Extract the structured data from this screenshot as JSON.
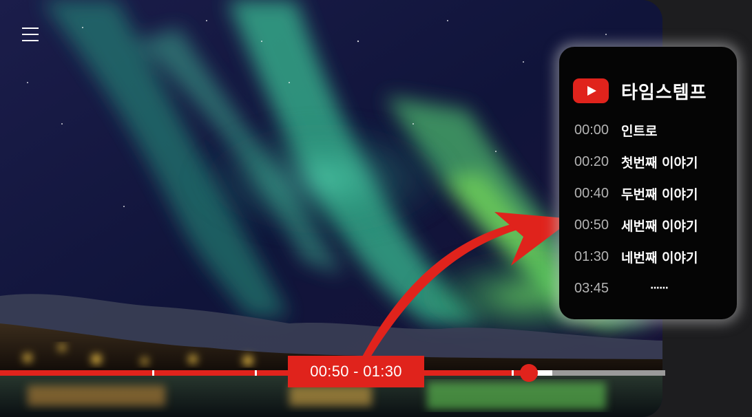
{
  "player": {
    "time_range_label": "00:50 - 01:30",
    "progress": {
      "played_fraction": 0.795,
      "buffered_fraction": 0.83,
      "chapter_marker_fractions": [
        0.229,
        0.383,
        0.769
      ]
    }
  },
  "icons": {
    "menu": "hamburger-menu-icon",
    "logo": "youtube-play-icon"
  },
  "timestamps_panel": {
    "title": "타임스템프",
    "items": [
      {
        "time": "00:00",
        "label": "인트로"
      },
      {
        "time": "00:20",
        "label": "첫번째 이야기"
      },
      {
        "time": "00:40",
        "label": "두번째 이야기"
      },
      {
        "time": "00:50",
        "label": "세번째 이야기"
      },
      {
        "time": "01:30",
        "label": "네번째 이야기"
      },
      {
        "time": "03:45",
        "label": "······"
      }
    ]
  },
  "colors": {
    "accent_red": "#e0231c",
    "aurora_green": "#3fd9a0",
    "panel_bg": "#050505",
    "track_gray": "#9a9a9a"
  }
}
